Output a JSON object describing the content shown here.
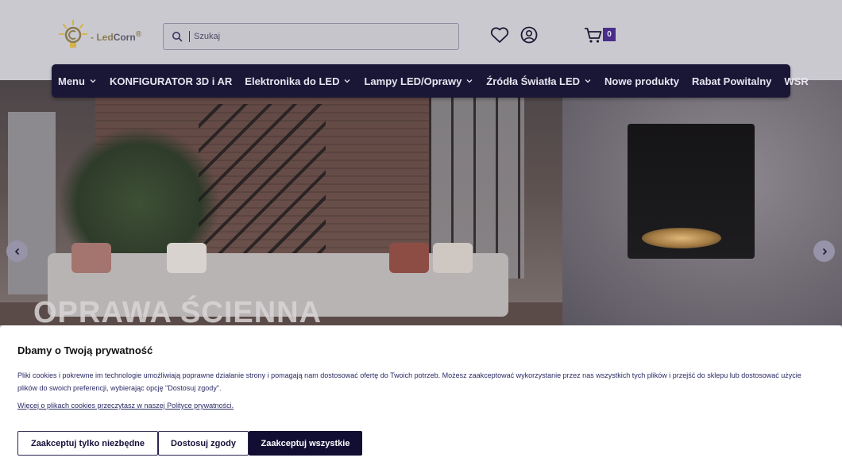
{
  "header": {
    "logo": {
      "text_led": "Led",
      "text_corn": "Corn",
      "mark": "®"
    },
    "search": {
      "placeholder": "Szukaj"
    },
    "cart": {
      "count": "0"
    },
    "icons": [
      "heart-icon",
      "user-icon",
      "cart-icon",
      "search-icon"
    ]
  },
  "nav": {
    "items": [
      {
        "label": "Menu",
        "dropdown": true
      },
      {
        "label": "KONFIGURATOR 3D i AR",
        "dropdown": false
      },
      {
        "label": "Elektronika do LED",
        "dropdown": true
      },
      {
        "label": "Lampy LED/Oprawy",
        "dropdown": true
      },
      {
        "label": "Źródła Światła LED",
        "dropdown": true
      },
      {
        "label": "Nowe produkty",
        "dropdown": false
      },
      {
        "label": "Rabat Powitalny",
        "dropdown": false
      },
      {
        "label": "WSR",
        "dropdown": false
      }
    ]
  },
  "hero": {
    "title": "OPRAWA ŚCIENNA"
  },
  "cookie": {
    "title": "Dbamy o Twoją prywatność",
    "text": "Pliki cookies i pokrewne im technologie umożliwiają poprawne działanie strony i pomagają nam dostosować ofertę do Twoich potrzeb. Możesz zaakceptować wykorzystanie przez nas wszystkich tych plików i przejść do sklepu lub dostosować użycie plików do swoich preferencji, wybierając opcję \"Dostosuj zgody\".",
    "link": "Więcej o plikach cookies przeczytasz w naszej Polityce prywatności.",
    "buttons": {
      "necessary": "Zaakceptuj tylko niezbędne",
      "customize": "Dostosuj zgody",
      "accept_all": "Zaakceptuj wszystkie"
    }
  },
  "colors": {
    "nav_bg": "#1a1636",
    "accent": "#4a2d8b",
    "button_dark": "#120d33",
    "logo_gold": "#d4b24a"
  }
}
